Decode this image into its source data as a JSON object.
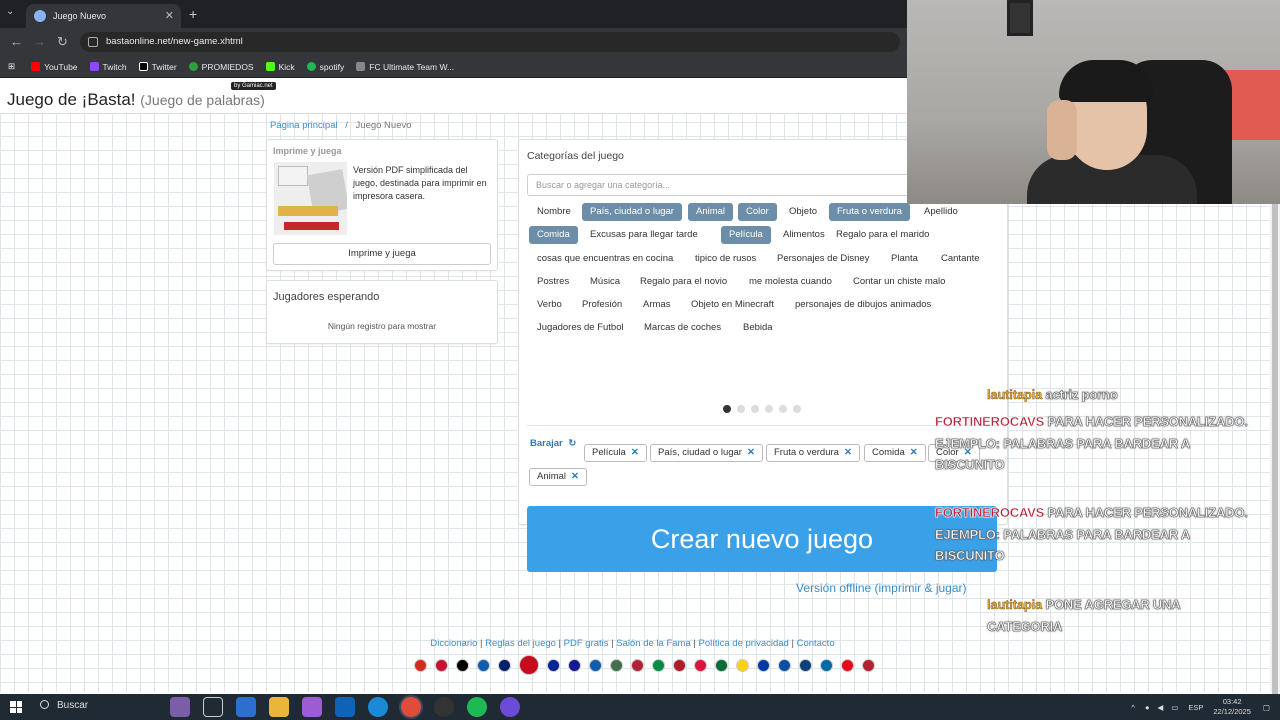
{
  "browser": {
    "tab_title": "Juego Nuevo",
    "url": "bastaonline.net/new-game.xhtml",
    "bookmarks": [
      "YouTube",
      "Twitch",
      "Twitter",
      "PROMIEDOS",
      "Kick",
      "spotify",
      "FC Ultimate Team W..."
    ]
  },
  "site": {
    "title": "Juego de ¡Basta!",
    "subtitle": "(Juego de palabras)",
    "badge": "by Gamiac.net"
  },
  "breadcrumb": {
    "home": "Página principal",
    "sep": "/",
    "current": "Juego Nuevo"
  },
  "print_panel": {
    "heading": "Imprime y juega",
    "description": "Versión PDF simplificada del juego, destinada para imprimir en impresora casera.",
    "button": "Imprime y juega"
  },
  "players_panel": {
    "heading": "Jugadores esperando",
    "empty": "Ningún registro para mostrar"
  },
  "categories": {
    "heading": "Categorías del juego",
    "search_placeholder": "Buscar o agregar una categoría...",
    "rows": [
      [
        {
          "label": "Nombre",
          "selected": false
        },
        {
          "label": "País, ciudad o lugar",
          "selected": true
        },
        {
          "label": "Animal",
          "selected": true
        },
        {
          "label": "Color",
          "selected": true
        },
        {
          "label": "Objeto",
          "selected": false
        },
        {
          "label": "Fruta o verdura",
          "selected": true
        },
        {
          "label": "Apellido",
          "selected": false
        }
      ],
      [
        {
          "label": "Comida",
          "selected": true
        },
        {
          "label": "Excusas para llegar tarde",
          "selected": false
        },
        {
          "label": "Película",
          "selected": true
        },
        {
          "label": "Alimentos",
          "selected": false
        },
        {
          "label": "Regalo para el marido",
          "selected": false
        }
      ],
      [
        {
          "label": "cosas que encuentras en cocina",
          "selected": false
        },
        {
          "label": "tipico de rusos",
          "selected": false
        },
        {
          "label": "Personajes de Disney",
          "selected": false
        },
        {
          "label": "Planta",
          "selected": false
        },
        {
          "label": "Cantante",
          "selected": false
        }
      ],
      [
        {
          "label": "Postres",
          "selected": false
        },
        {
          "label": "Música",
          "selected": false
        },
        {
          "label": "Regalo para el novio",
          "selected": false
        },
        {
          "label": "me molesta cuando",
          "selected": false
        },
        {
          "label": "Contar un chiste malo",
          "selected": false
        }
      ],
      [
        {
          "label": "Verbo",
          "selected": false
        },
        {
          "label": "Profesión",
          "selected": false
        },
        {
          "label": "Armas",
          "selected": false
        },
        {
          "label": "Objeto en Minecraft",
          "selected": false
        },
        {
          "label": "personajes de dibujos animados",
          "selected": false
        }
      ],
      [
        {
          "label": "Jugadores de Futbol",
          "selected": false
        },
        {
          "label": "Marcas de coches",
          "selected": false
        },
        {
          "label": "Bebida",
          "selected": false
        }
      ]
    ],
    "pages_total": 6,
    "page_active": 1,
    "shuffle_label": "Barajar",
    "selected_list": [
      "Película",
      "País, ciudad o lugar",
      "Fruta o verdura",
      "Comida",
      "Color",
      "Animal"
    ],
    "create_button": "Crear nuevo juego",
    "offline_link": "Versión offline (imprimir & jugar)"
  },
  "footer": {
    "links": [
      "Diccionario",
      "Reglas del juego",
      "PDF gratis",
      "Salón de la Fama",
      "Política de privacidad",
      "Contacto"
    ],
    "flag_colors": [
      "#d52b1e",
      "#c8102e",
      "#000000",
      "#0d5eaf",
      "#012169",
      "#c60b1e",
      "#002395",
      "#171796",
      "#0d5eaf",
      "#436f4d",
      "#b22234",
      "#008c45",
      "#ae1c28",
      "#dc143c",
      "#046a38",
      "#fcd116",
      "#0039a6",
      "#0b4ea2",
      "#0c4076",
      "#006aa7",
      "#e30a17",
      "#b22234"
    ]
  },
  "chat": [
    {
      "user": "lautitapia",
      "message": "actriz porno"
    },
    {
      "user": "FORTINEROCAVS",
      "message": "PARA HACER PERSONALIZADO. EJEMPLO: PALABRAS PARA BARDEAR A BISCUNITO"
    },
    {
      "user": "FORTINEROCAVS",
      "message": "PARA HACER PERSONALIZADO. EJEMPLO: PALABRAS PARA BARDEAR A BISCUNITO"
    },
    {
      "user": "lautitapia",
      "message": "PONE AGREGAR UNA CATEGORIA"
    }
  ],
  "taskbar": {
    "search": "Buscar",
    "lang": "ESP",
    "time": "03:42",
    "date": "22/12/2025"
  }
}
